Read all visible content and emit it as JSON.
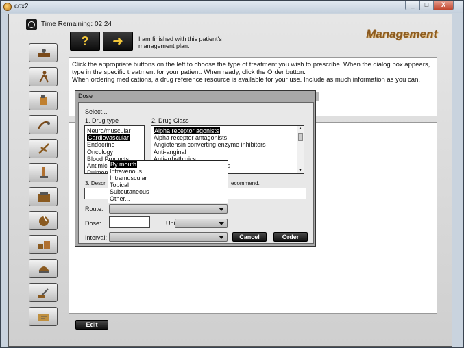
{
  "window": {
    "title": "ccx2",
    "minimize": "_",
    "maximize": "□",
    "close": "X"
  },
  "header": {
    "time_label": "Time Remaining: 02:24",
    "section_title": "Management",
    "help_button": "?",
    "next_button": "➜",
    "finished_text": "I am finished with this patient's management plan."
  },
  "instructions": {
    "line1": "Click the appropriate buttons on the left to choose the type of treatment you wish to prescribe. When the dialog box appears, type in the specific treatment for your patient. When ready, click the Order button.",
    "line2": "When ordering medications, a drug reference resource is available for your use. Include as much information as you can."
  },
  "sidebar": {
    "items": [
      {
        "icon": "admit-patient-icon"
      },
      {
        "icon": "physical-activity-icon"
      },
      {
        "icon": "medication-icon"
      },
      {
        "icon": "therapy-icon"
      },
      {
        "icon": "surgery-icon"
      },
      {
        "icon": "lab-test-icon"
      },
      {
        "icon": "imaging-icon"
      },
      {
        "icon": "diet-icon"
      },
      {
        "icon": "equipment-icon"
      },
      {
        "icon": "consult-phone-icon"
      },
      {
        "icon": "procedure-icon"
      },
      {
        "icon": "education-icon"
      }
    ]
  },
  "edit_button": "Edit",
  "dialog": {
    "title": "Dose",
    "select_label": "Select...",
    "drug_type_label": "1. Drug type",
    "drug_types": [
      "Neuro/muscular",
      "Cardiovascular",
      "Endocrine",
      "Oncology",
      "Blood Products",
      "Antimic",
      "Pulmon"
    ],
    "drug_type_selected": 1,
    "drug_class_label": "2. Drug Class",
    "drug_classes": [
      "Alpha receptor agonists",
      "Alpha receptor antagonists",
      "Angiotensin converting enzyme inhibitors",
      "Anti-anginal",
      "Antiarrhythmics",
      "",
      "ics"
    ],
    "drug_class_selected": 0,
    "describe_label": "3. Descri",
    "recommend_label": "ecommend.",
    "route_label": "Route:",
    "dose_label": "Dose:",
    "units_label": "Units:",
    "interval_label": "Interval:",
    "cancel_button": "Cancel",
    "order_button": "Order",
    "route_options": [
      "By mouth",
      "Intravenous",
      "Intramuscular",
      "Topical",
      "Subcutaneous",
      "Other..."
    ],
    "route_selected": 0
  }
}
